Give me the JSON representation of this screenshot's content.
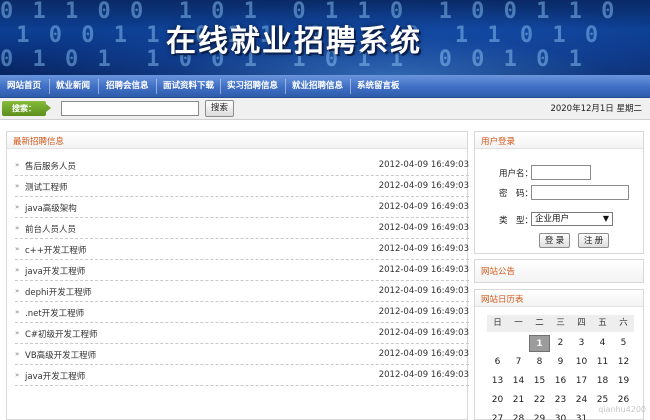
{
  "banner": {
    "title": "在线就业招聘系统",
    "digits": "0 1 1 0 0  1 0 1  0 1 1 0  1 0 0 1 1 0\n 1 0 0 1 1  0 1 1  0 0 1 0  1 1 0 1 0\n0 1 0 1  1 0 0 1  1 0 1 1  0 0 1 0 1"
  },
  "nav": {
    "items": [
      {
        "label": "网站首页"
      },
      {
        "label": "就业新闻"
      },
      {
        "label": "招聘会信息"
      },
      {
        "label": "面试资料下载"
      },
      {
        "label": "实习招聘信息"
      },
      {
        "label": "就业招聘信息"
      },
      {
        "label": "系统留言板"
      }
    ]
  },
  "search": {
    "label": "搜索：",
    "value": "",
    "button": "搜索",
    "date": "2020年12月1日 星期二"
  },
  "jobs": {
    "title": "最新招聘信息",
    "bullet": "»",
    "rows": [
      {
        "name": "售后服务人员",
        "time": "2012-04-09 16:49:03"
      },
      {
        "name": "测试工程师",
        "time": "2012-04-09 16:49:03"
      },
      {
        "name": "java高级架构",
        "time": "2012-04-09 16:49:03"
      },
      {
        "name": "前台人员人员",
        "time": "2012-04-09 16:49:03"
      },
      {
        "name": "c++开发工程师",
        "time": "2012-04-09 16:49:03"
      },
      {
        "name": "java开发工程师",
        "time": "2012-04-09 16:49:03"
      },
      {
        "name": "dephi开发工程师",
        "time": "2012-04-09 16:49:03"
      },
      {
        "name": ".net开发工程师",
        "time": "2012-04-09 16:49:03"
      },
      {
        "name": "C#初级开发工程师",
        "time": "2012-04-09 16:49:03"
      },
      {
        "name": "VB高级开发工程师",
        "time": "2012-04-09 16:49:03"
      },
      {
        "name": "java开发工程师",
        "time": "2012-04-09 16:49:03"
      }
    ]
  },
  "login": {
    "title": "用户登录",
    "username_label": "用户名：",
    "password_label": "密　码：",
    "type_label": "类　型：",
    "type_value": "企业用户",
    "login_button": "登 录",
    "register_button": "注 册"
  },
  "notice": {
    "title": "网站公告"
  },
  "calendar": {
    "title": "网站日历表",
    "weekdays": [
      "日",
      "一",
      "二",
      "三",
      "四",
      "五",
      "六"
    ],
    "today": "1",
    "weeks": [
      [
        "",
        "",
        "1",
        "2",
        "3",
        "4",
        "5"
      ],
      [
        "6",
        "7",
        "8",
        "9",
        "10",
        "11",
        "12"
      ],
      [
        "13",
        "14",
        "15",
        "16",
        "17",
        "18",
        "19"
      ],
      [
        "20",
        "21",
        "22",
        "23",
        "24",
        "25",
        "26"
      ],
      [
        "27",
        "28",
        "29",
        "30",
        "31",
        "",
        ""
      ]
    ]
  },
  "watermark": "qianhu4200",
  "colors": {
    "accent_title": "#d2591a",
    "nav_bg": "#3f6fc4",
    "search_label_bg": "#6fa22a"
  }
}
